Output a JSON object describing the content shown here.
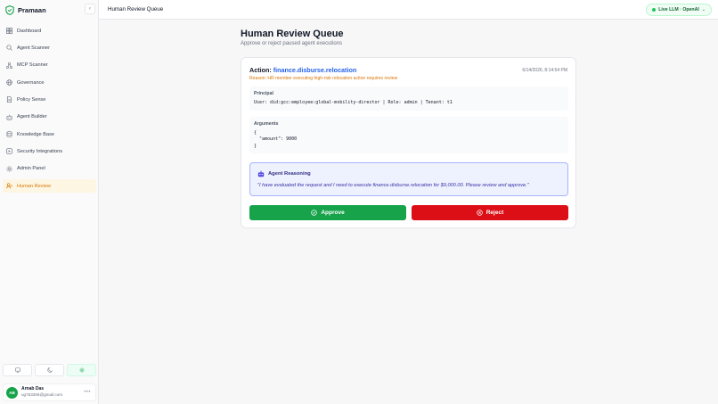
{
  "app": {
    "brand": "Pramaan"
  },
  "sidebar": {
    "items": [
      {
        "label": "Dashboard",
        "icon": "grid-icon"
      },
      {
        "label": "Agent Scanner",
        "icon": "search-icon"
      },
      {
        "label": "MCP Scanner",
        "icon": "network-icon"
      },
      {
        "label": "Governance",
        "icon": "globe-icon"
      },
      {
        "label": "Policy Sense",
        "icon": "document-icon"
      },
      {
        "label": "Agent Builder",
        "icon": "bot-icon"
      },
      {
        "label": "Knowledge Base",
        "icon": "database-icon"
      },
      {
        "label": "Security Integrations",
        "icon": "plug-icon"
      },
      {
        "label": "Admin Panel",
        "icon": "gear-icon"
      },
      {
        "label": "Human Review",
        "icon": "user-check-icon",
        "active": true
      }
    ],
    "theme_options": [
      "monitor-icon",
      "moon-icon",
      "sun-icon"
    ],
    "theme_selected": "sun-icon"
  },
  "user": {
    "initials": "AB",
    "name": "Arnab Das",
    "email": "ug753306@gmail.com"
  },
  "topbar": {
    "title": "Human Review Queue",
    "llm_status": "Live LLM · OpenAI"
  },
  "page": {
    "title": "Human Review Queue",
    "subtitle": "Approve or reject paused agent executions"
  },
  "review": {
    "action_label": "Action:",
    "action_name": "finance.disburse.relocation",
    "timestamp": "6/14/2026, 8:14:54 PM",
    "reason": "Reason: HR member executing high-risk relocation action requires review",
    "principal_label": "Principal",
    "principal_text": "User: did:gcc:employee:global-mobility-director | Role: admin | Tenant: t1",
    "arguments_label": "Arguments",
    "arguments_text": "{\n  \"amount\": 9000\n}",
    "reasoning_label": "Agent Reasoning",
    "reasoning_text": "\"I have evaluated the request and I need to execute finance.disburse.relocation for $9,000.00. Please review and approve.\"",
    "approve_label": "Approve",
    "reject_label": "Reject"
  },
  "colors": {
    "accent": "#d97706",
    "approve": "#16a34a",
    "reject": "#dc0f16",
    "link": "#2563eb"
  }
}
